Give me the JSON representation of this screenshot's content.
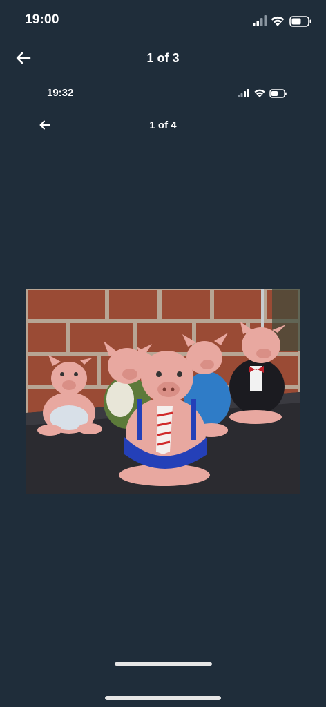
{
  "status_bar": {
    "time": "19:00",
    "icons": [
      "cellular-signal-icon",
      "wifi-icon",
      "battery-icon"
    ]
  },
  "nav": {
    "back_icon": "arrow-left-icon",
    "title": "1 of 3"
  },
  "embedded_screenshot": {
    "status_bar": {
      "time": "19:32",
      "icons": [
        "cellular-signal-icon",
        "wifi-icon",
        "battery-icon"
      ]
    },
    "nav": {
      "back_icon": "arrow-left-icon",
      "title": "1 of 4"
    }
  },
  "photo": {
    "subject": "Five pink ceramic pig piggy banks on a dark mat in front of a brick wall",
    "colors": {
      "brick": "#9a4b35",
      "mortar": "#c9b8a8",
      "pig": "#e8a8a0",
      "mat": "#2b2b30"
    }
  },
  "colors": {
    "background": "#1f2d3a",
    "text": "#ffffff",
    "home_indicator": "#e6e6e6"
  }
}
